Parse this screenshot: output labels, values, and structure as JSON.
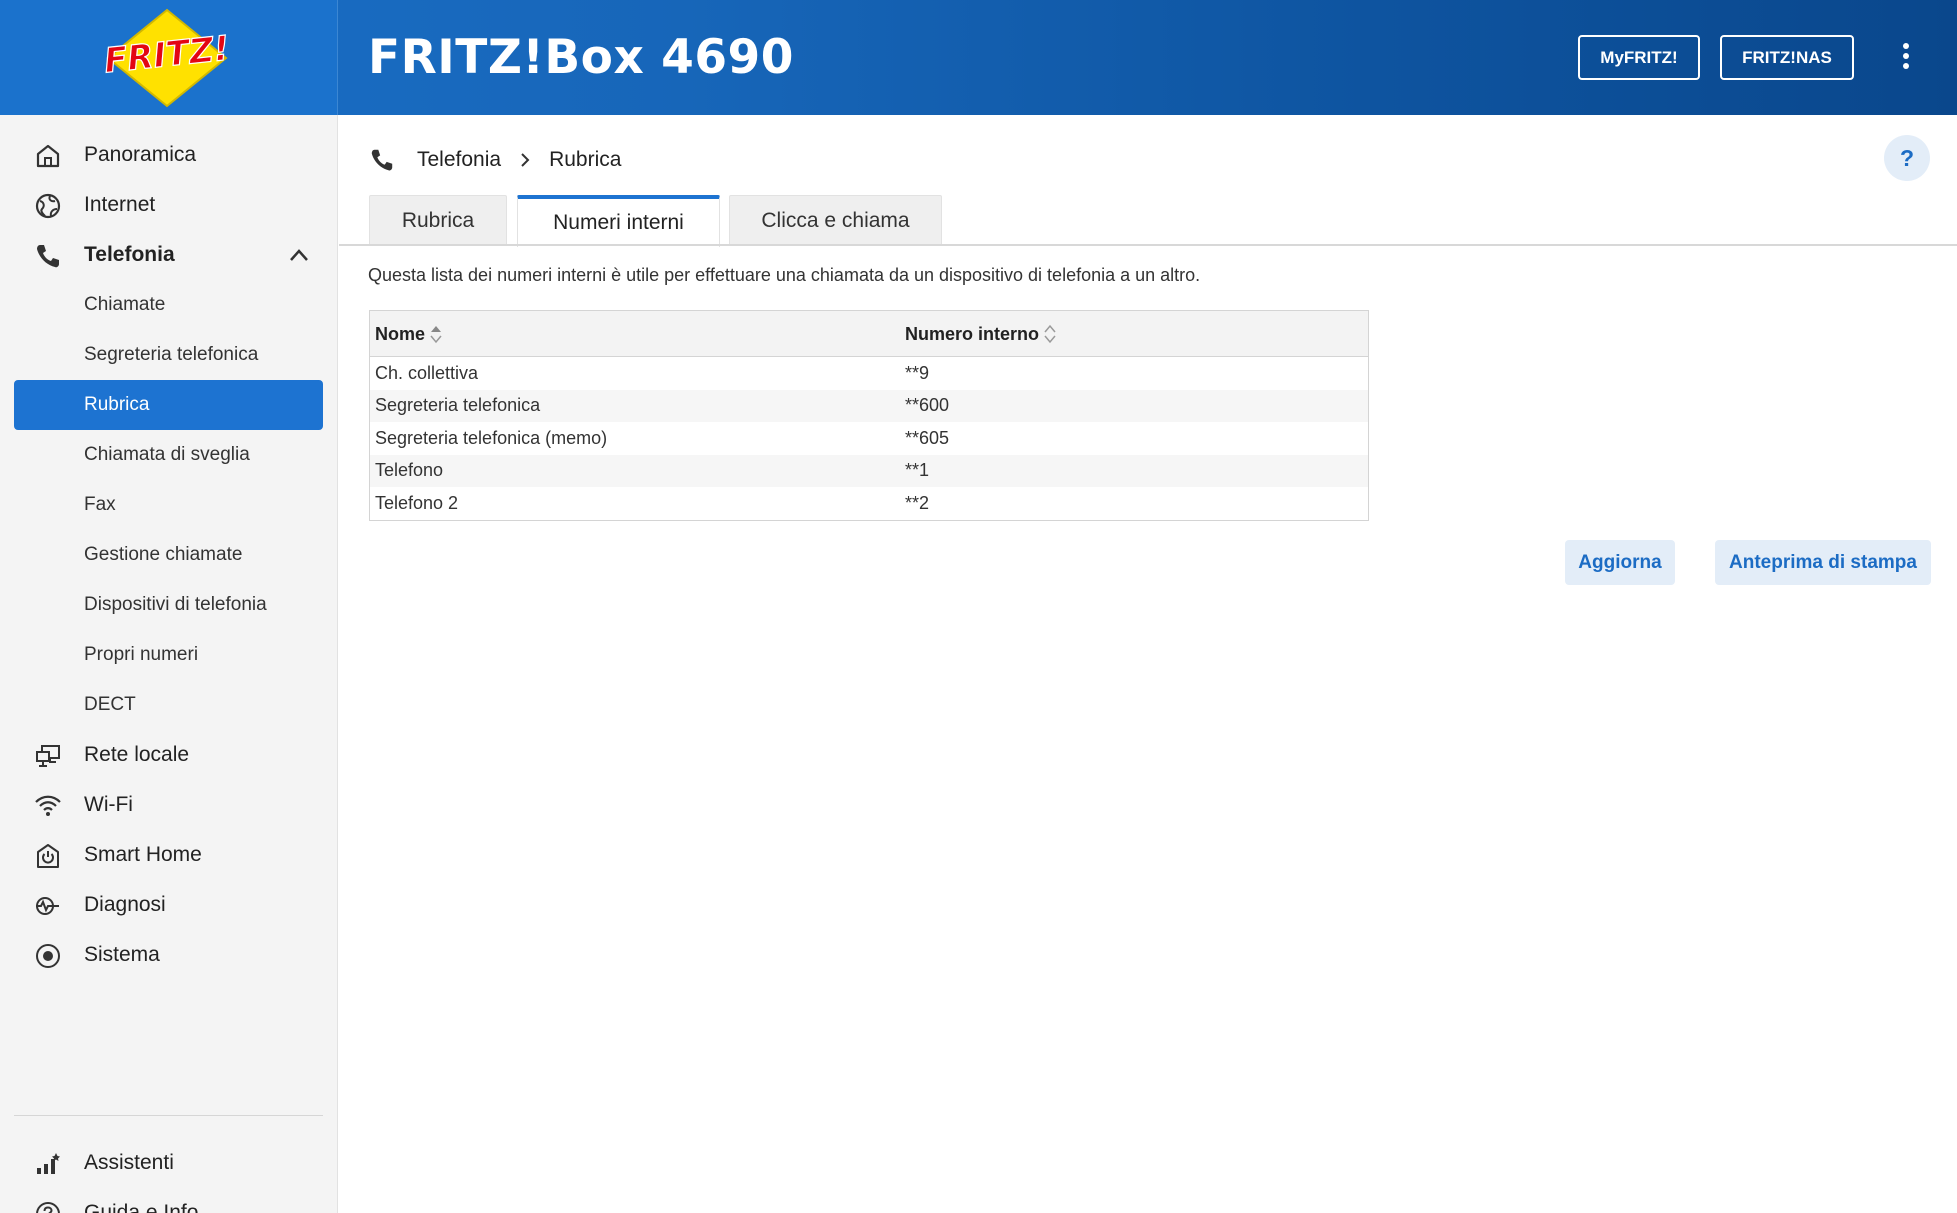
{
  "header": {
    "logo_text": "FRITZ!",
    "product": "FRITZ!Box 4690",
    "myfritz_label": "MyFRITZ!",
    "fritznas_label": "FRITZ!NAS",
    "menu_icon": "kebab-menu-icon"
  },
  "sidebar": {
    "items": [
      {
        "label": "Panoramica",
        "icon": "home-icon"
      },
      {
        "label": "Internet",
        "icon": "globe-icon"
      },
      {
        "label": "Telefonia",
        "icon": "phone-icon",
        "expanded": true
      },
      {
        "label": "Rete locale",
        "icon": "network-icon"
      },
      {
        "label": "Wi-Fi",
        "icon": "wifi-icon"
      },
      {
        "label": "Smart Home",
        "icon": "smarthome-icon"
      },
      {
        "label": "Diagnosi",
        "icon": "diagnostics-icon"
      },
      {
        "label": "Sistema",
        "icon": "system-icon"
      }
    ],
    "sub_items": [
      {
        "label": "Chiamate"
      },
      {
        "label": "Segreteria telefonica"
      },
      {
        "label": "Rubrica",
        "active": true
      },
      {
        "label": "Chiamata di sveglia"
      },
      {
        "label": "Fax"
      },
      {
        "label": "Gestione chiamate"
      },
      {
        "label": "Dispositivi di telefonia"
      },
      {
        "label": "Propri numeri"
      },
      {
        "label": "DECT"
      }
    ],
    "bottom": [
      {
        "label": "Assistenti",
        "icon": "wizard-icon"
      },
      {
        "label": "Guida e Info",
        "icon": "help-circle-icon"
      }
    ]
  },
  "breadcrumb": {
    "section": "Telefonia",
    "page": "Rubrica"
  },
  "help_label": "?",
  "tabs": [
    {
      "label": "Rubrica",
      "active": false
    },
    {
      "label": "Numeri interni",
      "active": true
    },
    {
      "label": "Clicca e chiama",
      "active": false
    }
  ],
  "intro": "Questa lista dei numeri interni è utile per effettuare una chiamata da un dispositivo di telefonia a un altro.",
  "table": {
    "columns": [
      "Nome",
      "Numero interno"
    ],
    "rows": [
      [
        "Ch. collettiva",
        "**9"
      ],
      [
        "Segreteria telefonica",
        "**600"
      ],
      [
        "Segreteria telefonica (memo)",
        "**605"
      ],
      [
        "Telefono",
        "**1"
      ],
      [
        "Telefono 2",
        "**2"
      ]
    ]
  },
  "actions": {
    "refresh_label": "Aggiorna",
    "print_label": "Anteprima di stampa"
  },
  "colors": {
    "accent": "#1d73d1",
    "header_start": "#1a6fc7",
    "header_end": "#0a478c",
    "button_bg": "#e3edf8"
  }
}
